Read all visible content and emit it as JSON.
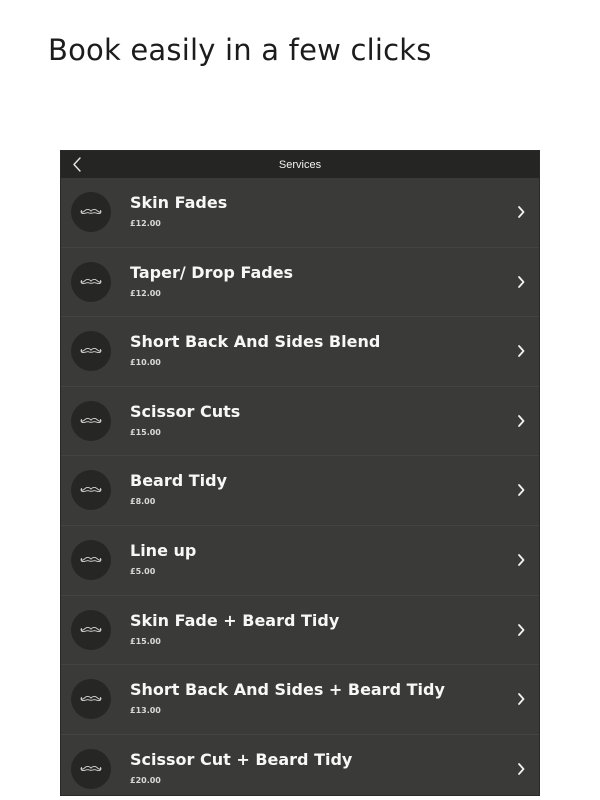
{
  "headline": "Book easily in a few clicks",
  "navbar": {
    "title": "Services",
    "back_icon": "chevron-left-icon"
  },
  "services": [
    {
      "name": "Skin Fades",
      "price": "£12.00"
    },
    {
      "name": "Taper/ Drop Fades",
      "price": "£12.00"
    },
    {
      "name": "Short Back And Sides Blend",
      "price": "£10.00"
    },
    {
      "name": "Scissor Cuts",
      "price": "£15.00"
    },
    {
      "name": "Beard Tidy",
      "price": "£8.00"
    },
    {
      "name": "Line up",
      "price": "£5.00"
    },
    {
      "name": "Skin Fade + Beard Tidy",
      "price": "£15.00"
    },
    {
      "name": "Short Back And Sides + Beard Tidy",
      "price": "£13.00"
    },
    {
      "name": "Scissor Cut + Beard Tidy",
      "price": "£20.00"
    }
  ],
  "icons": {
    "row_icon": "moustache-icon",
    "row_action": "chevron-right-icon"
  },
  "colors": {
    "background": "#ffffff",
    "list_background": "#3a3a38",
    "navbar_background": "#252523",
    "icon_circle": "#262624",
    "text_primary": "#f7f7f7"
  }
}
